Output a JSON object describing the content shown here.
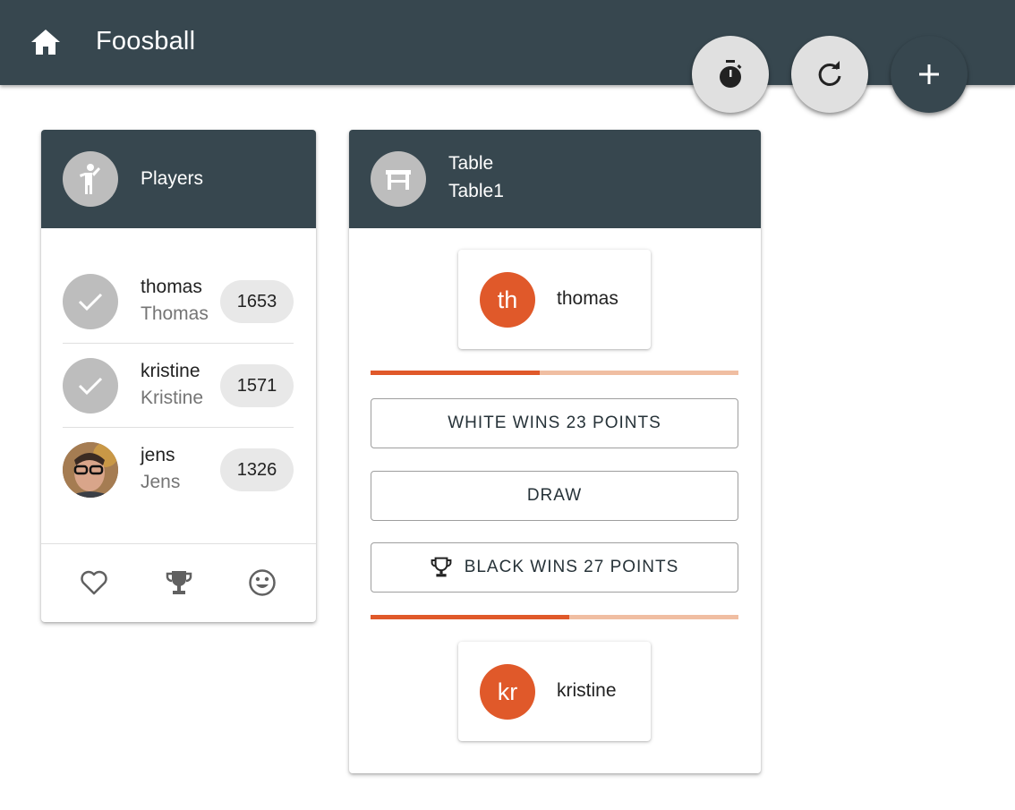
{
  "app_bar": {
    "title": "Foosball",
    "home_icon": "home-icon",
    "background": "#37474f"
  },
  "fabs": [
    {
      "icon": "stopwatch-icon"
    },
    {
      "icon": "refresh-icon"
    },
    {
      "icon": "add-icon"
    }
  ],
  "players_card": {
    "title": "Players",
    "header_icon": "person-icon",
    "players": [
      {
        "username": "thomas",
        "name": "Thomas",
        "score": "1653",
        "avatar": "check-icon"
      },
      {
        "username": "kristine",
        "name": "Kristine",
        "score": "1571",
        "avatar": "check-icon"
      },
      {
        "username": "jens",
        "name": "Jens",
        "score": "1326",
        "avatar": "photo"
      }
    ],
    "footer_icons": [
      "heart-icon",
      "trophy-icon",
      "smiley-icon"
    ]
  },
  "table_card": {
    "title": "Table",
    "subtitle": "Table1",
    "header_icon": "table-icon",
    "white_player": {
      "initials": "th",
      "name": "thomas"
    },
    "white_progress": 0.46,
    "actions": {
      "white_wins": "WHITE WINS 23 POINTS",
      "draw": "DRAW",
      "black_wins": "BLACK WINS 27 POINTS"
    },
    "black_progress": 0.54,
    "black_player": {
      "initials": "kr",
      "name": "kristine"
    }
  },
  "colors": {
    "accent": "#e0592a",
    "accent_light": "#f0bea2",
    "header": "#37474f"
  }
}
